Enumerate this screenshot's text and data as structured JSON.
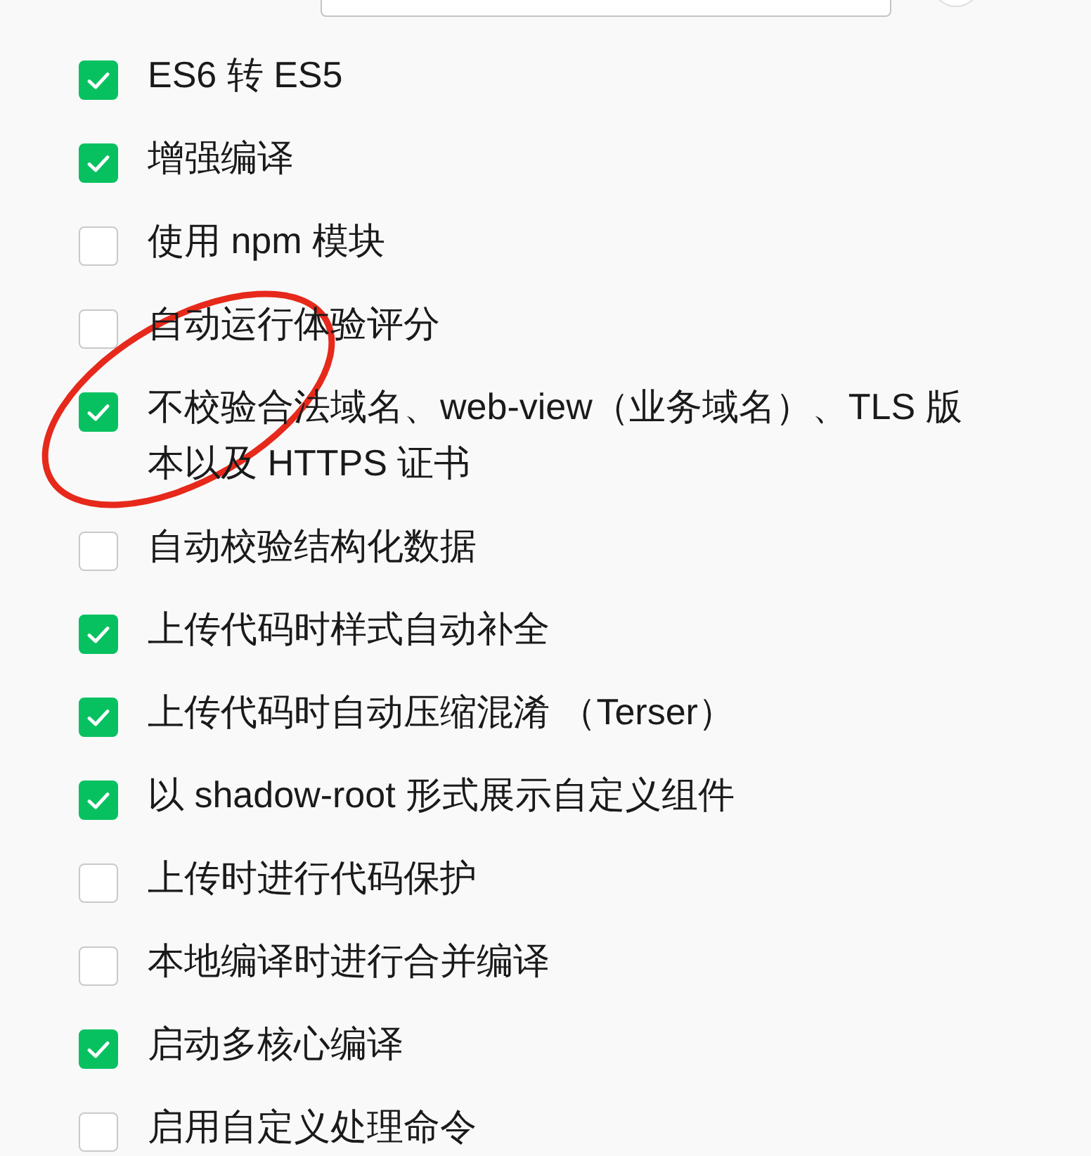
{
  "options": [
    {
      "label": "ES6 转 ES5",
      "checked": true,
      "circled": false
    },
    {
      "label": "增强编译",
      "checked": true,
      "circled": false
    },
    {
      "label": "使用 npm 模块",
      "checked": false,
      "circled": false
    },
    {
      "label": "自动运行体验评分",
      "checked": false,
      "circled": false
    },
    {
      "label": "不校验合法域名、web-view（业务域名）、TLS 版本以及 HTTPS 证书",
      "checked": true,
      "circled": true
    },
    {
      "label": "自动校验结构化数据",
      "checked": false,
      "circled": false
    },
    {
      "label": "上传代码时样式自动补全",
      "checked": true,
      "circled": false
    },
    {
      "label": "上传代码时自动压缩混淆 （Terser）",
      "checked": true,
      "circled": false
    },
    {
      "label": "以 shadow-root 形式展示自定义组件",
      "checked": true,
      "circled": false
    },
    {
      "label": "上传时进行代码保护",
      "checked": false,
      "circled": false
    },
    {
      "label": "本地编译时进行合并编译",
      "checked": false,
      "circled": false
    },
    {
      "label": "启动多核心编译",
      "checked": true,
      "circled": false
    },
    {
      "label": "启用自定义处理命令",
      "checked": false,
      "circled": false
    }
  ]
}
